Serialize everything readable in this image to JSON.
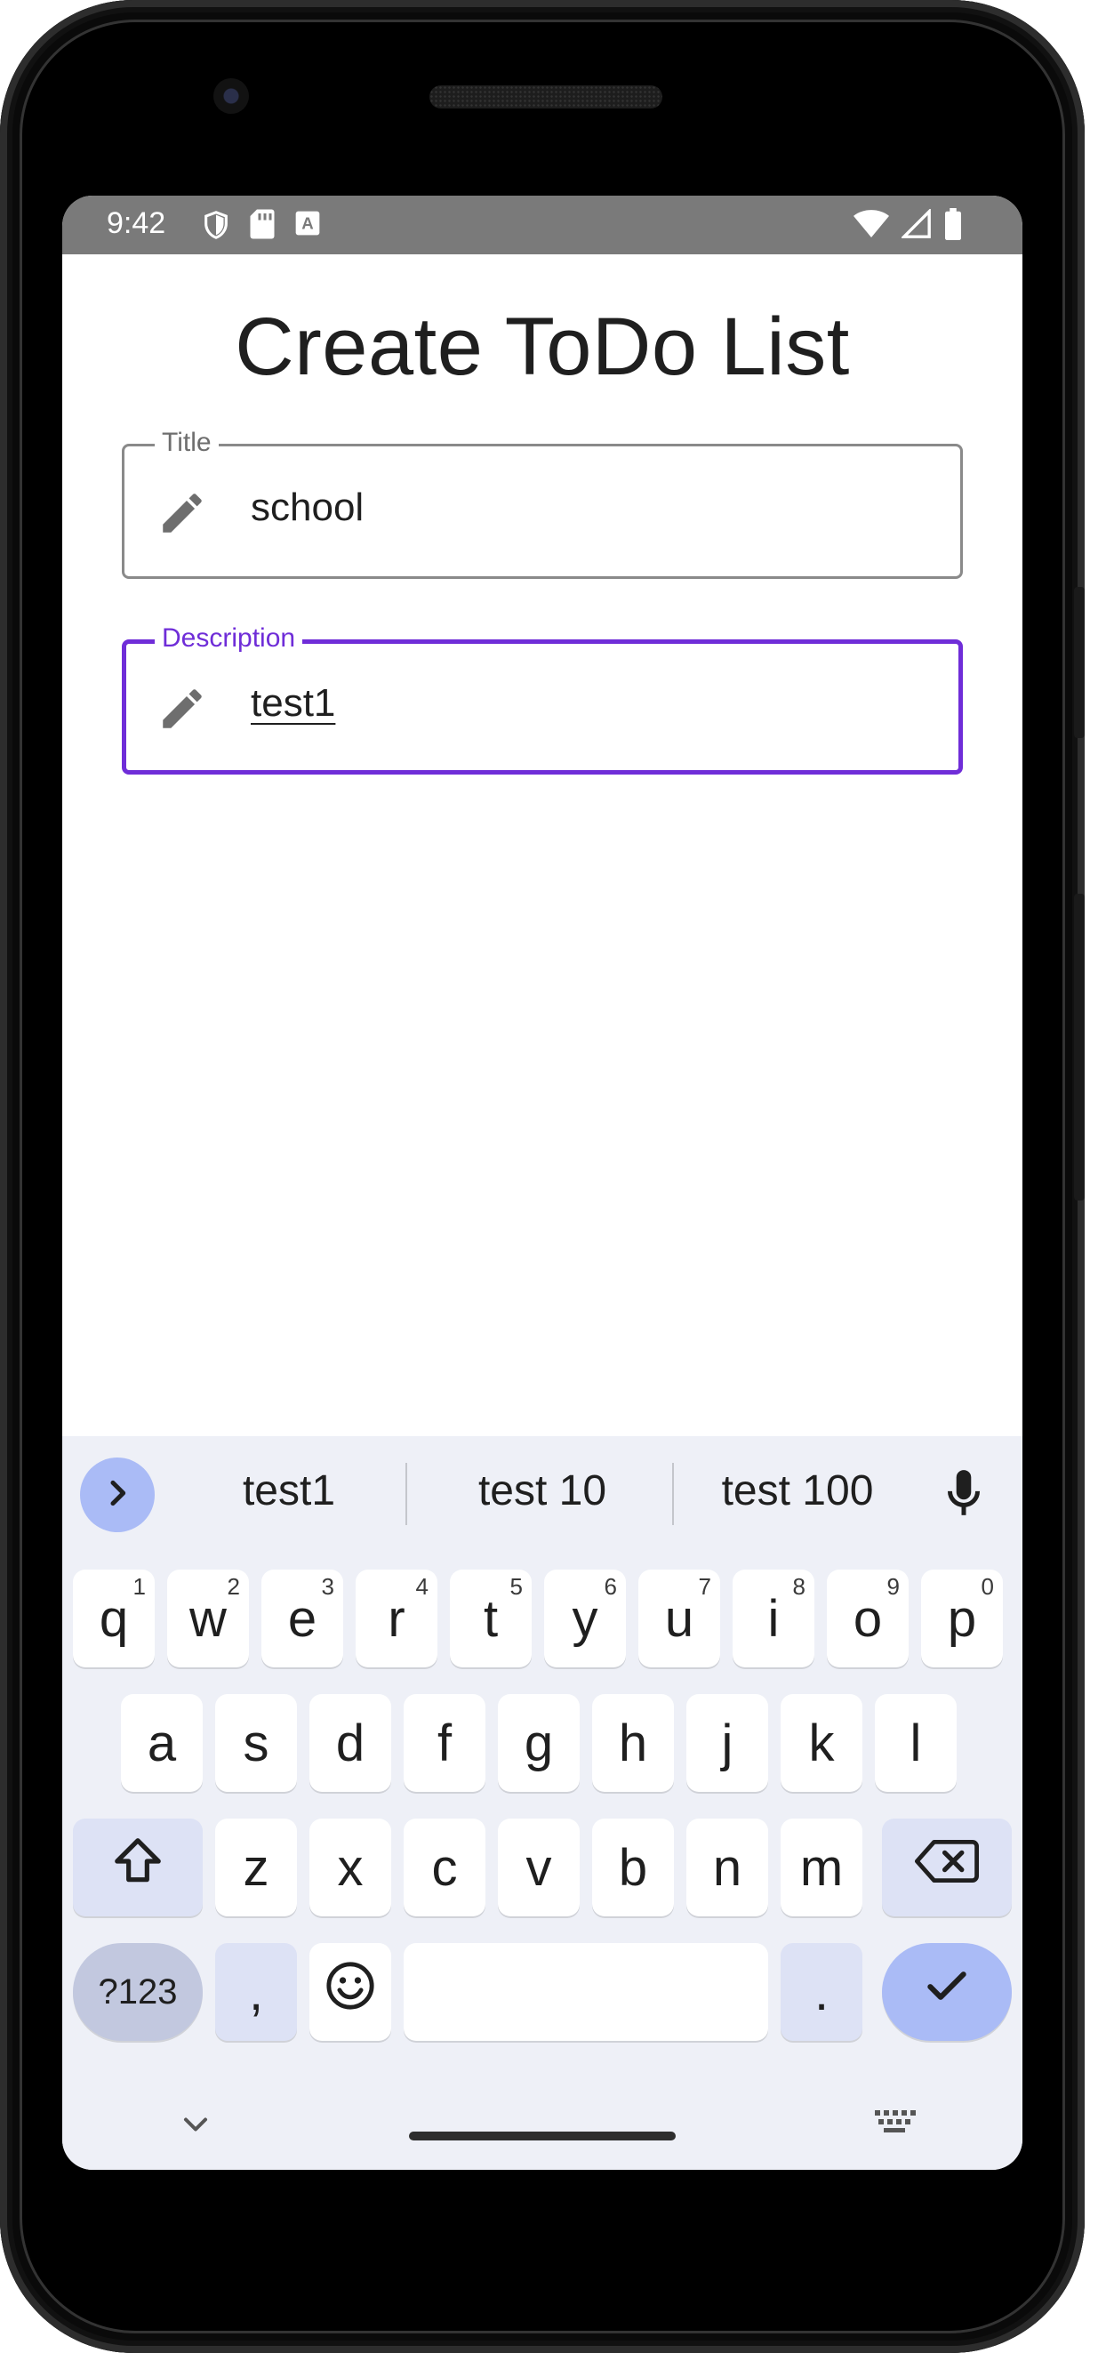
{
  "status_bar": {
    "time": "9:42",
    "left_icons": [
      "shield-icon",
      "sd-card-icon",
      "keyboard-a-icon"
    ],
    "right_icons": [
      "wifi-icon",
      "signal-icon",
      "battery-icon"
    ],
    "background": "#7a7a7a"
  },
  "page": {
    "title": "Create ToDo List"
  },
  "form": {
    "title_field": {
      "label": "Title",
      "value": "school",
      "icon": "pencil-icon"
    },
    "description_field": {
      "label": "Description",
      "value": "test1",
      "icon": "pencil-icon",
      "focused": true,
      "accent": "#6f2dd8"
    }
  },
  "keyboard": {
    "suggestions": [
      "test1",
      "test 10",
      "test 100"
    ],
    "row1": [
      {
        "k": "q",
        "h": "1"
      },
      {
        "k": "w",
        "h": "2"
      },
      {
        "k": "e",
        "h": "3"
      },
      {
        "k": "r",
        "h": "4"
      },
      {
        "k": "t",
        "h": "5"
      },
      {
        "k": "y",
        "h": "6"
      },
      {
        "k": "u",
        "h": "7"
      },
      {
        "k": "i",
        "h": "8"
      },
      {
        "k": "o",
        "h": "9"
      },
      {
        "k": "p",
        "h": "0"
      }
    ],
    "row2": [
      "a",
      "s",
      "d",
      "f",
      "g",
      "h",
      "j",
      "k",
      "l"
    ],
    "row3": [
      "z",
      "x",
      "c",
      "v",
      "b",
      "n",
      "m"
    ],
    "symbols_label": "?123",
    "comma_label": ",",
    "period_label": ".",
    "accent": "#aabbf6"
  }
}
